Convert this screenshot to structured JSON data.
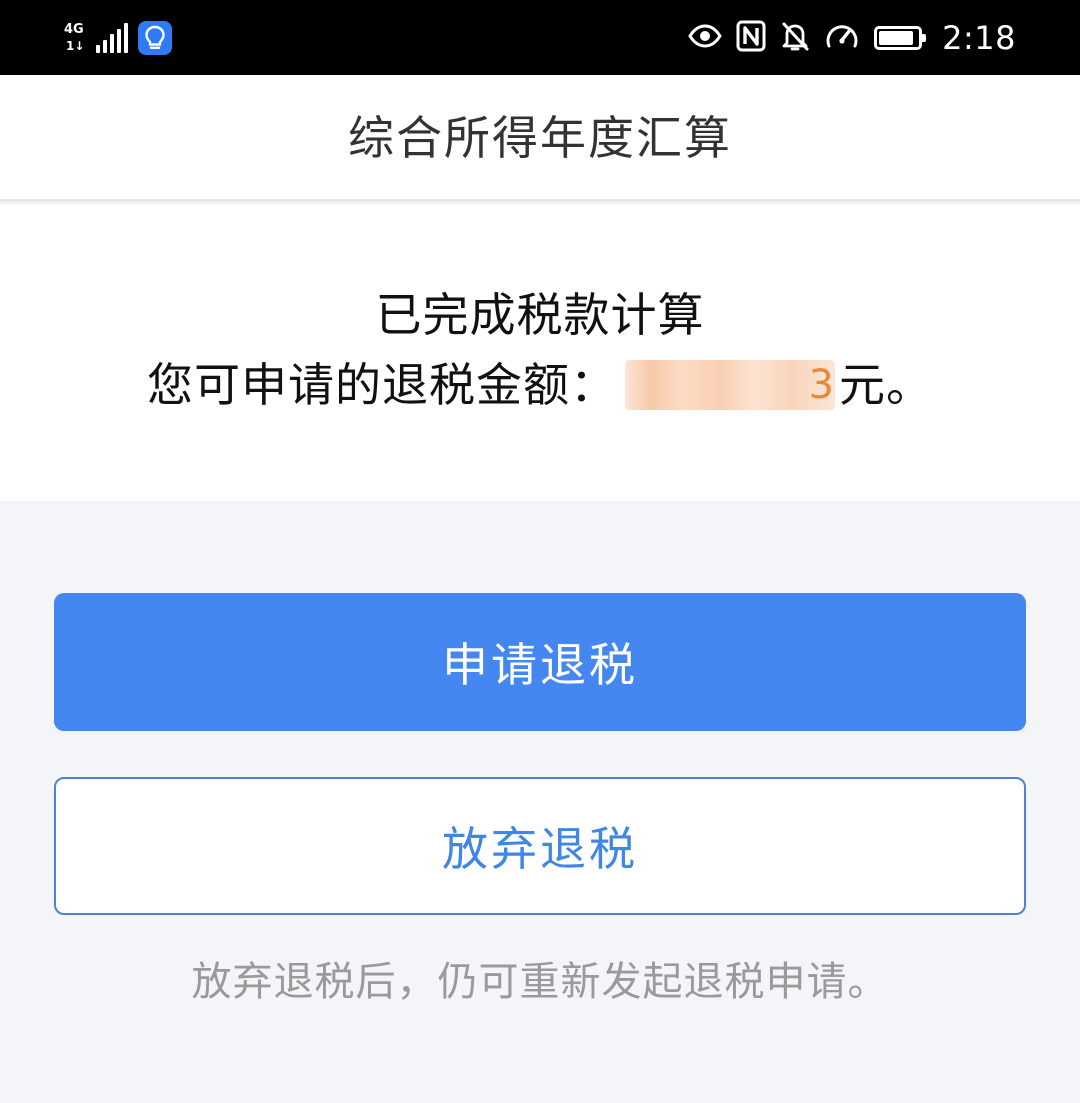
{
  "status_bar": {
    "network_type": "4G",
    "network_activity": "1↓",
    "signal_bars": 5,
    "app_notification_icon": "lightbulb-icon",
    "icons": [
      "eye-icon",
      "nfc-icon",
      "bell-muted-icon",
      "speedometer-icon"
    ],
    "battery_level": 0.9,
    "time": "2:18"
  },
  "header": {
    "title": "综合所得年度汇算"
  },
  "result": {
    "line1": "已完成税款计算",
    "amount_label": "您可申请的退税金额：",
    "amount_visible": "3",
    "amount_suffix": "元。"
  },
  "actions": {
    "apply_label": "申请退税",
    "abandon_label": "放弃退税"
  },
  "hint": "放弃退税后，仍可重新发起退税申请。",
  "colors": {
    "primary": "#4587f1",
    "outline": "#4a84d8",
    "amount": "#e98838",
    "hint": "#9a9a9a"
  }
}
